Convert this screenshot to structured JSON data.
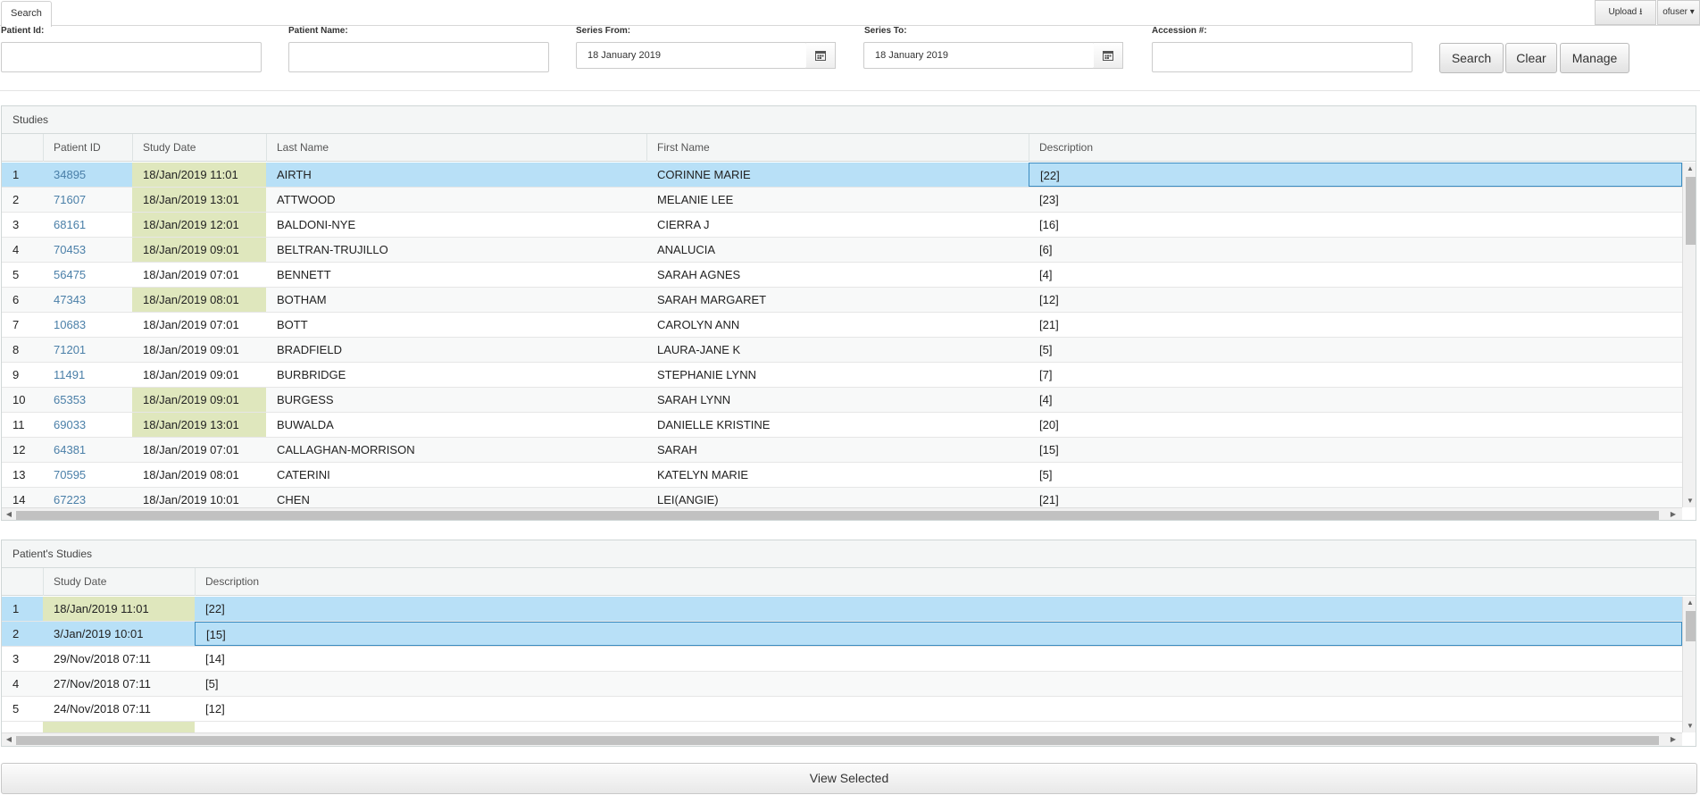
{
  "tabs": [
    {
      "label": "Search"
    }
  ],
  "top_right": {
    "upload_label": "Upload",
    "user_label": "ofuser"
  },
  "form": {
    "patient_id_label": "Patient Id:",
    "patient_id_value": "",
    "patient_name_label": "Patient Name:",
    "patient_name_value": "",
    "series_from_label": "Series From:",
    "series_from_value": "18 January 2019",
    "series_to_label": "Series To:",
    "series_to_value": "18 January 2019",
    "accession_label": "Accession #:",
    "accession_value": "",
    "search_label": "Search",
    "clear_label": "Clear",
    "manage_label": "Manage"
  },
  "studies": {
    "title": "Studies",
    "columns": [
      "Patient ID",
      "Study Date",
      "Last Name",
      "First Name",
      "Description"
    ],
    "rows": [
      {
        "n": "1",
        "id": "34895",
        "date": "18/Jan/2019 11:01",
        "last": "AIRTH",
        "first": "CORINNE MARIE",
        "desc": "[22]",
        "hl": true,
        "sel": true
      },
      {
        "n": "2",
        "id": "71607",
        "date": "18/Jan/2019 13:01",
        "last": "ATTWOOD",
        "first": "MELANIE LEE",
        "desc": "[23]",
        "hl": true
      },
      {
        "n": "3",
        "id": "68161",
        "date": "18/Jan/2019 12:01",
        "last": "BALDONI-NYE",
        "first": "CIERRA J",
        "desc": "[16]",
        "hl": true
      },
      {
        "n": "4",
        "id": "70453",
        "date": "18/Jan/2019 09:01",
        "last": "BELTRAN-TRUJILLO",
        "first": "ANALUCIA",
        "desc": "[6]",
        "hl": true
      },
      {
        "n": "5",
        "id": "56475",
        "date": "18/Jan/2019 07:01",
        "last": "BENNETT",
        "first": "SARAH AGNES",
        "desc": "[4]",
        "hl": false
      },
      {
        "n": "6",
        "id": "47343",
        "date": "18/Jan/2019 08:01",
        "last": "BOTHAM",
        "first": "SARAH MARGARET",
        "desc": "[12]",
        "hl": true
      },
      {
        "n": "7",
        "id": "10683",
        "date": "18/Jan/2019 07:01",
        "last": "BOTT",
        "first": "CAROLYN ANN",
        "desc": "[21]",
        "hl": false
      },
      {
        "n": "8",
        "id": "71201",
        "date": "18/Jan/2019 09:01",
        "last": "BRADFIELD",
        "first": "LAURA-JANE K",
        "desc": "[5]",
        "hl": false
      },
      {
        "n": "9",
        "id": "11491",
        "date": "18/Jan/2019 09:01",
        "last": "BURBRIDGE",
        "first": "STEPHANIE LYNN",
        "desc": "[7]",
        "hl": false
      },
      {
        "n": "10",
        "id": "65353",
        "date": "18/Jan/2019 09:01",
        "last": "BURGESS",
        "first": "SARAH LYNN",
        "desc": "[4]",
        "hl": true
      },
      {
        "n": "11",
        "id": "69033",
        "date": "18/Jan/2019 13:01",
        "last": "BUWALDA",
        "first": "DANIELLE KRISTINE",
        "desc": "[20]",
        "hl": true
      },
      {
        "n": "12",
        "id": "64381",
        "date": "18/Jan/2019 07:01",
        "last": "CALLAGHAN-MORRISON",
        "first": "SARAH",
        "desc": "[15]",
        "hl": false
      },
      {
        "n": "13",
        "id": "70595",
        "date": "18/Jan/2019 08:01",
        "last": "CATERINI",
        "first": "KATELYN MARIE",
        "desc": "[5]",
        "hl": false
      },
      {
        "n": "14",
        "id": "67223",
        "date": "18/Jan/2019 10:01",
        "last": "CHEN",
        "first": "LEI(ANGIE)",
        "desc": "[21]",
        "hl": false
      }
    ]
  },
  "patient_studies": {
    "title": "Patient's Studies",
    "columns": [
      "Study Date",
      "Description"
    ],
    "rows": [
      {
        "n": "1",
        "date": "18/Jan/2019 11:01",
        "desc": "[22]",
        "hl": true,
        "sel": true
      },
      {
        "n": "2",
        "date": "3/Jan/2019 10:01",
        "desc": "[15]",
        "hl": false,
        "sel": true
      },
      {
        "n": "3",
        "date": "29/Nov/2018 07:11",
        "desc": "[14]",
        "hl": false
      },
      {
        "n": "4",
        "date": "27/Nov/2018 07:11",
        "desc": "[5]",
        "hl": false
      },
      {
        "n": "5",
        "date": "24/Nov/2018 07:11",
        "desc": "[12]",
        "hl": false
      }
    ]
  },
  "footer": {
    "view_selected_label": "View Selected"
  },
  "colors": {
    "selected_row": "#b8e0f7",
    "date_highlight": "#dfe7bd",
    "link": "#4a7fa8"
  }
}
